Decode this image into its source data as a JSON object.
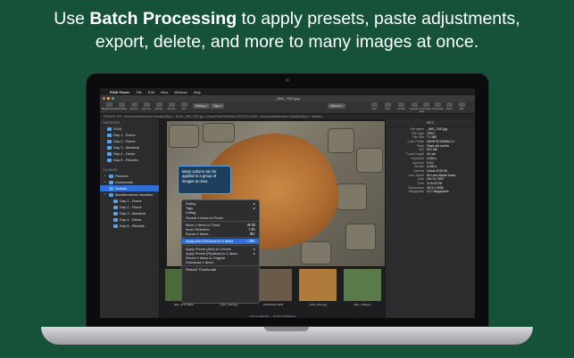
{
  "headline": {
    "pre": "Use ",
    "bold": "Batch Processing",
    "post": " to apply presets, paste adjustments,",
    "line2": "export, delete, and more to many images at once."
  },
  "menubar": {
    "app": "RAW Power",
    "items": [
      "File",
      "Edit",
      "View",
      "Window",
      "Help"
    ]
  },
  "window": {
    "title": "_IMG_7187.jpg"
  },
  "toolbar": {
    "left": [
      "Back/Forward",
      "Add Folder",
      "Favorite",
      "New Vol",
      "Ratings",
      "Browse",
      "Sort",
      "Ratings",
      "Tags"
    ],
    "ratings": "Ratings ▾",
    "tags": "Tags ▾",
    "medium": "Medium ▾",
    "right": [
      "Color",
      "Tools",
      "Info/GB",
      "Inspector",
      "Thumbnail Size",
      "Thumbnails",
      "Views",
      "Edit"
    ]
  },
  "pathbar": "PRIVATE.JPG  ~/Users/david/adventure Vacation/Day 1 - Rome          _IMG_7187.jpg  ~/Users/Pictures/Selects          DSC07031.ARW  ~/Users/david/adventure Vacation/Day 3 - Messina",
  "sidebar": {
    "favorites_label": "FAVORITES",
    "favorites": [
      "2018",
      "Day 1 - Rome",
      "Day 2 - Rome",
      "Day 3 - Messina",
      "Day 4 - Delos",
      "Day 5 - Rhodes"
    ],
    "folders_label": "FOLDERS",
    "folders": [
      {
        "label": "Pictures",
        "indent": 1,
        "tri": "▸",
        "sel": false
      },
      {
        "label": "Downloads",
        "indent": 1,
        "tri": "▸",
        "sel": false
      },
      {
        "label": "Selects",
        "indent": 1,
        "tri": "",
        "sel": true
      },
      {
        "label": "Mediterranean Vacation",
        "indent": 1,
        "tri": "▾",
        "sel": false
      },
      {
        "label": "Day 1 - Rome",
        "indent": 2,
        "tri": "",
        "sel": false
      },
      {
        "label": "Day 2 - Rome",
        "indent": 2,
        "tri": "",
        "sel": false
      },
      {
        "label": "Day 3 - Messina",
        "indent": 2,
        "tri": "",
        "sel": false
      },
      {
        "label": "Day 4 - Delos",
        "indent": 2,
        "tri": "",
        "sel": false
      },
      {
        "label": "Day 5 - Rhodes",
        "indent": 2,
        "tri": "",
        "sel": false
      }
    ]
  },
  "tooltip": "Many actions can be applied to a group of images at once.",
  "context_menu": [
    {
      "label": "Rating",
      "shortcut": "▸"
    },
    {
      "label": "Tags",
      "shortcut": "▸"
    },
    {
      "label": "Unflag",
      "shortcut": ""
    },
    {
      "label": "Reveal 4 Items in Finder",
      "shortcut": ""
    },
    {
      "sep": true
    },
    {
      "label": "Move 4 Items to Trash",
      "shortcut": "⌘⌫"
    },
    {
      "label": "Invert Selection",
      "shortcut": "⇧⌘I"
    },
    {
      "label": "Export 4 Items...",
      "shortcut": "⌘E"
    },
    {
      "sep": true
    },
    {
      "label": "Apply Auto Enhance to 4 Items",
      "shortcut": "⌥⌘E",
      "sel": true
    },
    {
      "sep": true
    },
    {
      "label": "Apply Preset (Add) to 4 Items",
      "shortcut": "▸"
    },
    {
      "label": "Apply Preset (Replace) to 4 Items",
      "shortcut": "▸"
    },
    {
      "label": "Revert 4 Items to Original",
      "shortcut": ""
    },
    {
      "label": "Download 4 Items",
      "shortcut": ""
    },
    {
      "sep": true
    },
    {
      "label": "Rebuild Thumbnails",
      "shortcut": ""
    }
  ],
  "inspector": {
    "title": "INFO",
    "rows": [
      [
        "File Name",
        "_IMG_7187.jpg"
      ],
      [
        "File Type",
        "JPEG"
      ],
      [
        "File Size",
        "7.1 MB"
      ],
      [
        "Color Profile",
        "sRGB IEC61966-2.1"
      ],
      [
        "Flash",
        "Flash did not fire"
      ],
      [
        "ISO",
        "ISO 400"
      ],
      [
        "Focal Length",
        "40 mm"
      ],
      [
        "Exposure",
        "1/400 s"
      ],
      [
        "Aperture",
        "f/ 9.0"
      ],
      [
        "Shutter",
        "1/160 s"
      ],
      [
        "Camera",
        "Canon EOS 5D"
      ],
      [
        "Lens Model",
        "No Lens Model found"
      ],
      [
        "Date",
        "Oct 13, 2007"
      ],
      [
        "Time",
        "3:15:13 PM"
      ],
      [
        "Dimensions",
        "4072 x 2956"
      ],
      [
        "Megapixels",
        "12.7 Megapixels"
      ]
    ]
  },
  "thumbnails": [
    {
      "caption": "IMG_2176.HEIC",
      "sel": false,
      "color": "#4a6a3a"
    },
    {
      "caption": "_IMG_7187.jpg",
      "sel": true,
      "color": "#9a6a3a"
    },
    {
      "caption": "DSC07031.ARW",
      "sel": false,
      "color": "#6a5a4a"
    },
    {
      "caption": "_IMG_7913.jpg",
      "sel": false,
      "color": "#b07a3a"
    },
    {
      "caption": "IMG_7158.jpg",
      "sel": false,
      "color": "#5a7a4a"
    }
  ],
  "status": "4 items selected — 70 items displayed",
  "colors": {
    "background": "#16523a",
    "selection": "#2f6fd6",
    "folder": "#5aa3e8"
  }
}
